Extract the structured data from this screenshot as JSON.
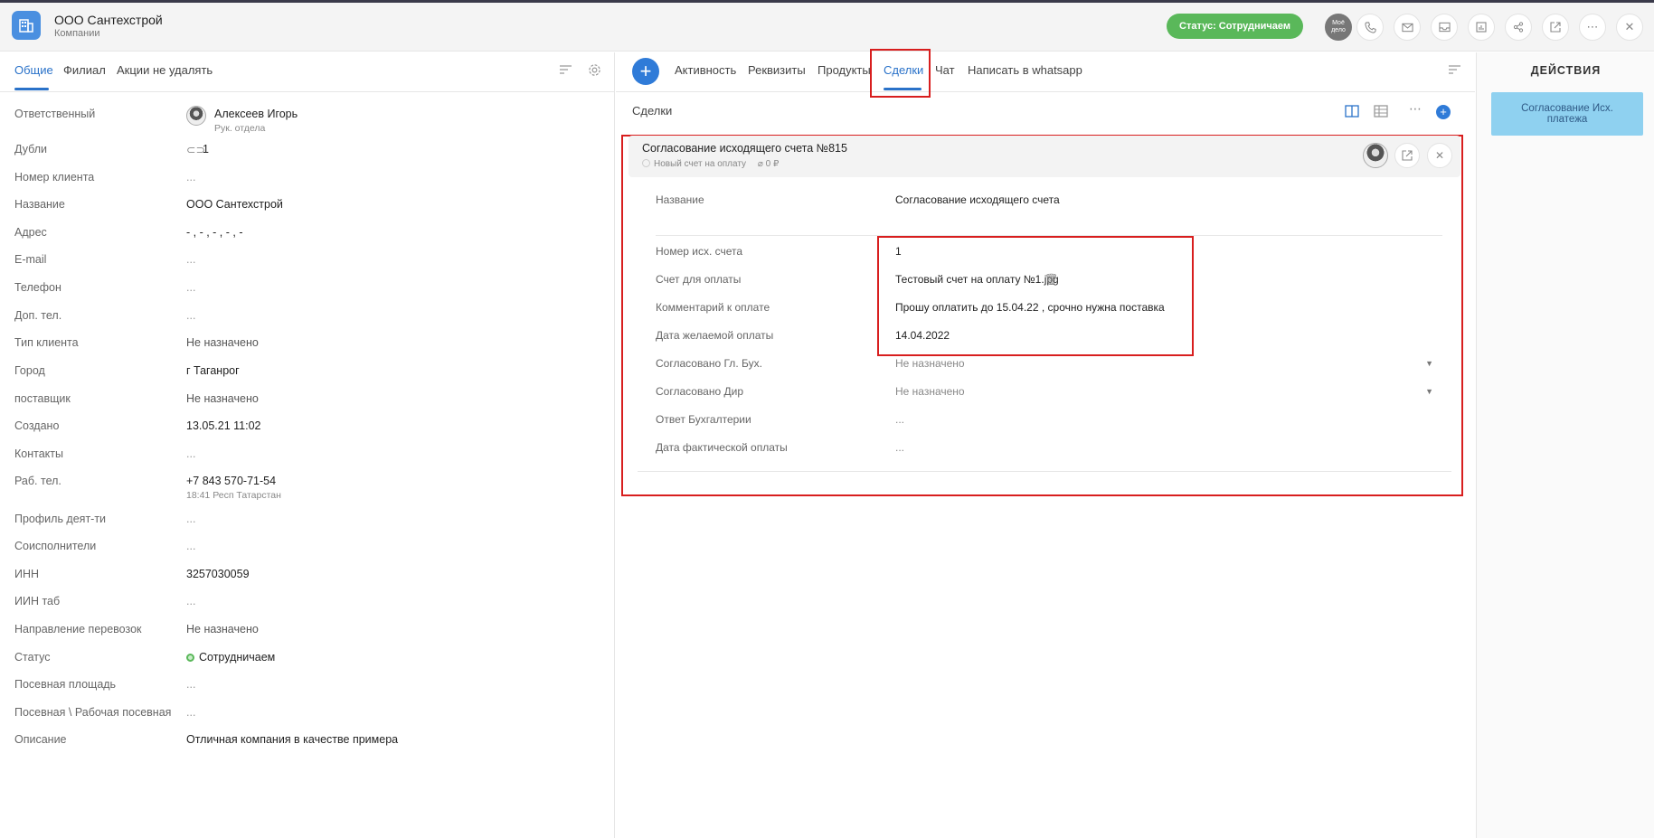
{
  "header": {
    "title": "ООО Сантехстрой",
    "subtitle": "Компании",
    "status": "Статус: Сотрудничаем",
    "moe_delo": "Моё дело"
  },
  "left": {
    "tabs": [
      "Общие",
      "Филиал",
      "Акции не удалять"
    ],
    "fields": [
      {
        "label": "Ответственный",
        "value": "Алексеев Игорь",
        "sub": "Рук. отдела"
      },
      {
        "label": "Дубли",
        "value": "1"
      },
      {
        "label": "Номер клиента",
        "value": "..."
      },
      {
        "label": "Название",
        "value": "ООО Сантехстрой"
      },
      {
        "label": "Адрес",
        "value": "- , - , - , - , -"
      },
      {
        "label": "E-mail",
        "value": "..."
      },
      {
        "label": "Телефон",
        "value": "..."
      },
      {
        "label": "Доп. тел.",
        "value": "..."
      },
      {
        "label": "Тип клиента",
        "value": "Не назначено"
      },
      {
        "label": "Город",
        "value": "г Таганрог"
      },
      {
        "label": "поставщик",
        "value": "Не назначено"
      },
      {
        "label": "Создано",
        "value": "13.05.21 11:02"
      },
      {
        "label": "Контакты",
        "value": "..."
      },
      {
        "label": "Раб. тел.",
        "value": "+7 843 570-71-54",
        "sub": "18:41 Респ Татарстан"
      },
      {
        "label": "Профиль деят-ти",
        "value": "..."
      },
      {
        "label": "Соисполнители",
        "value": "..."
      },
      {
        "label": "ИНН",
        "value": "3257030059"
      },
      {
        "label": "ИИН таб",
        "value": "..."
      },
      {
        "label": "Направление перевозок",
        "value": "Не назначено"
      },
      {
        "label": "Статус",
        "value": "Сотрудничаем"
      },
      {
        "label": "Посевная площадь",
        "value": "..."
      },
      {
        "label": "Посевная \\ Рабочая посевная",
        "value": "..."
      },
      {
        "label": "Описание",
        "value": "Отличная компания в качестве примера"
      }
    ]
  },
  "center": {
    "tabs": [
      "Активность",
      "Реквизиты",
      "Продукты",
      "Сделки",
      "Чат",
      "Написать в whatsapp"
    ],
    "section_title": "Сделки",
    "deal": {
      "title": "Согласование исходящего счета №815",
      "stage": "Новый счет на оплату",
      "amount": "0 ₽",
      "fields": [
        {
          "label": "Название",
          "value": "Согласование исходящего счета"
        },
        {
          "label": "Номер исх. счета",
          "value": "1"
        },
        {
          "label": "Счет для оплаты",
          "value": "Тестовый счет на оплату №1.jpg"
        },
        {
          "label": "Комментарий к оплате",
          "value": "Прошу оплатить до 15.04.22 , срочно нужна поставка"
        },
        {
          "label": "Дата желаемой оплаты",
          "value": "14.04.2022"
        },
        {
          "label": "Согласовано Гл. Бух.",
          "value": "Не назначено"
        },
        {
          "label": "Согласовано Дир",
          "value": "Не назначено"
        },
        {
          "label": "Ответ Бухгалтерии",
          "value": "..."
        },
        {
          "label": "Дата фактической оплаты",
          "value": "..."
        }
      ]
    }
  },
  "right": {
    "title": "ДЕЙСТВИЯ",
    "action": "Согласование Исх. платежа"
  },
  "colors": {
    "accent": "#2a72c9",
    "status_green": "#5ab85a",
    "highlight_red": "#d81e1e",
    "action_blue": "#8fd1f0"
  }
}
